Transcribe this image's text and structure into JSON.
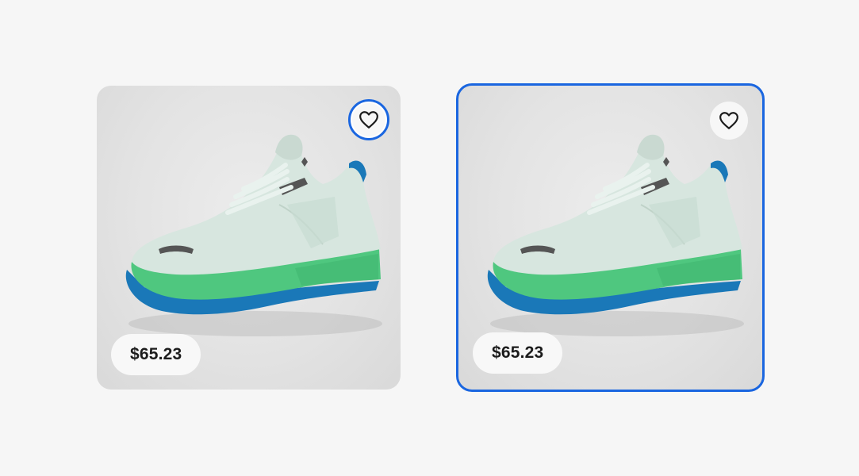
{
  "cards": [
    {
      "price": "$65.23",
      "favorite_icon": "heart-outline-icon",
      "state": "favorite-button-focused"
    },
    {
      "price": "$65.23",
      "favorite_icon": "heart-outline-icon",
      "state": "card-focused"
    }
  ],
  "colors": {
    "page_background": "#f6f6f6",
    "card_background": "#e3e3e3",
    "focus_ring": "#1a66e0",
    "shoe_upper": "#d7e6df",
    "shoe_midsole": "#4fc77f",
    "shoe_outsole": "#1a78b8"
  }
}
